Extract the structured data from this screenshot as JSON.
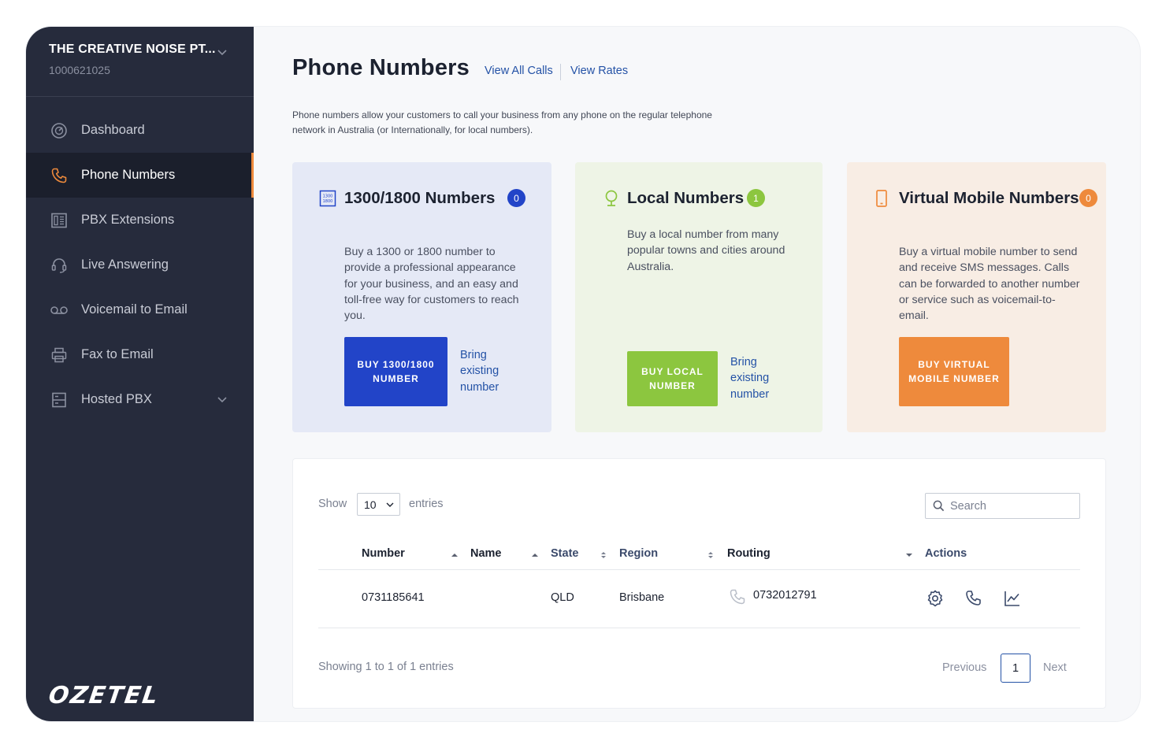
{
  "account": {
    "name": "THE CREATIVE NOISE PT...",
    "id": "1000621025"
  },
  "sidebar": {
    "items": [
      {
        "label": "Dashboard",
        "icon": "dashboard-gauge-icon"
      },
      {
        "label": "Phone Numbers",
        "icon": "phone-icon",
        "active": true
      },
      {
        "label": "PBX Extensions",
        "icon": "pbx-extensions-icon"
      },
      {
        "label": "Live Answering",
        "icon": "headset-icon"
      },
      {
        "label": "Voicemail to Email",
        "icon": "voicemail-icon"
      },
      {
        "label": "Fax to Email",
        "icon": "printer-icon"
      },
      {
        "label": "Hosted PBX",
        "icon": "server-icon"
      }
    ],
    "logo": "OZETEL"
  },
  "header": {
    "title": "Phone Numbers",
    "links": [
      "View All Calls",
      "View Rates"
    ],
    "intro": "Phone numbers allow your customers to call your business from any phone on the regular telephone network in Australia (or Internationally, for local numbers)."
  },
  "cards": [
    {
      "title": "1300/1800 Numbers",
      "count": "0",
      "description": "Buy a 1300 or 1800 number to provide a professional appearance for your business, and an easy and toll-free way for customers to reach you.",
      "button": "BUY 1300/1800 NUMBER",
      "link": "Bring existing number",
      "accent": "#2244c8"
    },
    {
      "title": "Local Numbers",
      "count": "1",
      "description": "Buy a local number from many popular towns and cities around Australia.",
      "button": "BUY LOCAL NUMBER",
      "link": "Bring existing number",
      "accent": "#8cc63f"
    },
    {
      "title": "Virtual Mobile Numbers",
      "count": "0",
      "description": "Buy a virtual mobile number to send and receive SMS messages. Calls can be forwarded to another number or service such as voicemail-to-email.",
      "button": "BUY VIRTUAL MOBILE NUMBER",
      "accent": "#ee8a3c"
    }
  ],
  "table": {
    "show_label": "Show",
    "entries_value": "10",
    "entries_label": "entries",
    "search_placeholder": "Search",
    "columns": [
      "Number",
      "Name",
      "State",
      "Region",
      "Routing",
      "Actions"
    ],
    "rows": [
      {
        "number": "0731185641",
        "name": "",
        "state": "QLD",
        "region": "Brisbane",
        "routing": "0732012791"
      }
    ],
    "showing": "Showing 1 to 1 of 1 entries",
    "pager": {
      "previous": "Previous",
      "page": "1",
      "next": "Next"
    }
  }
}
